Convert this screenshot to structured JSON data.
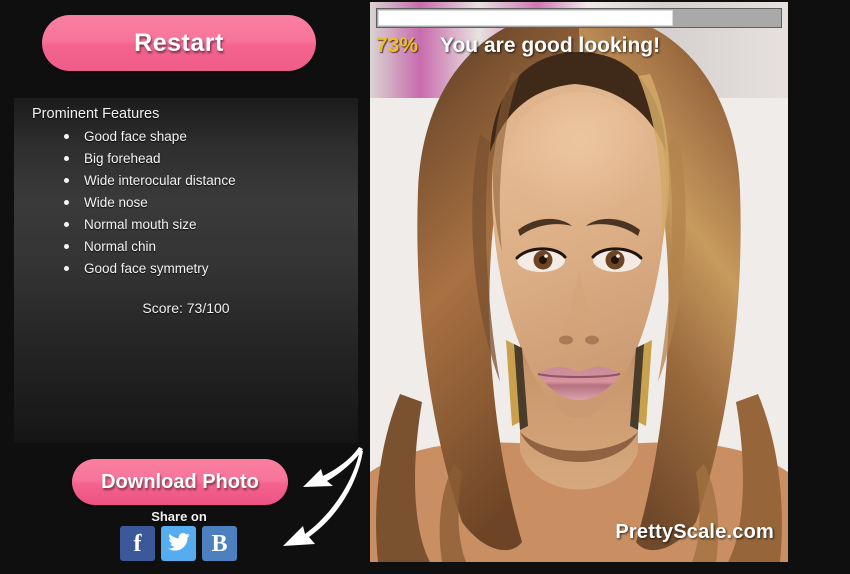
{
  "app": {
    "background_color": "#100f0f",
    "accent_pink": "#f4638e",
    "panel_gradient_top": "#1b1b1b",
    "panel_gradient_mid": "#3a3a3a"
  },
  "sidebar": {
    "restart_button": {
      "label": "Restart",
      "icon": "restart-button"
    },
    "features": {
      "title": "Prominent Features",
      "items": [
        "Good face shape",
        "Big forehead",
        "Wide interocular distance",
        "Wide nose",
        "Normal mouth size",
        "Normal chin",
        "Good face symmetry"
      ],
      "score_label": "Score: 73/100"
    },
    "download_button": {
      "label": "Download Photo"
    },
    "share": {
      "label": "Share on",
      "buttons": [
        {
          "name": "facebook",
          "glyph": "f",
          "color": "#3b5998"
        },
        {
          "name": "twitter",
          "glyph": "❦",
          "color": "#55acee"
        },
        {
          "name": "blogger",
          "glyph": "B",
          "color": "#4d80bf"
        }
      ]
    }
  },
  "photo_panel": {
    "progress": {
      "percent": 73,
      "fill_color": "#ffffff",
      "track_color": "#a9a9a9"
    },
    "verdict": {
      "percent_text": "73%",
      "percent_color": "#e9c122",
      "message": "You are good looking!"
    },
    "watermark": "PrettyScale.com",
    "subject": "portrait-photo"
  }
}
